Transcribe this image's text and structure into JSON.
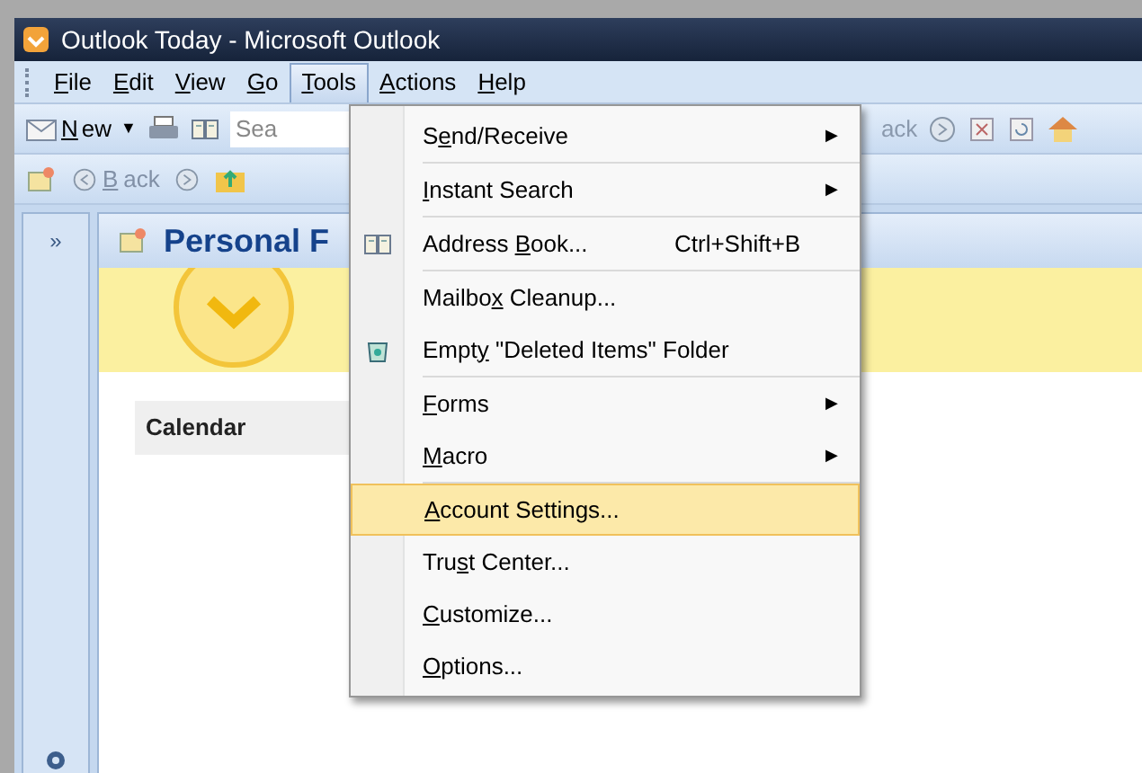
{
  "window": {
    "title": "Outlook Today - Microsoft Outlook"
  },
  "menu_bar": [
    {
      "key": "F",
      "after": "ile",
      "selected": false
    },
    {
      "key": "E",
      "after": "dit",
      "selected": false
    },
    {
      "key": "V",
      "after": "iew",
      "selected": false
    },
    {
      "key": "G",
      "after": "o",
      "selected": false
    },
    {
      "key": "T",
      "after": "ools",
      "selected": true
    },
    {
      "key": "A",
      "after": "ctions",
      "selected": false
    },
    {
      "key": "H",
      "after": "elp",
      "selected": false
    }
  ],
  "toolbar": {
    "new_button": {
      "key": "N",
      "after": "ew",
      "dropdown_glyph": "▼"
    },
    "search_text": "Sea",
    "back_text_cut": "ack"
  },
  "nav_toolbar": {
    "back_button": {
      "key": "B",
      "after": "ack"
    }
  },
  "nav_pane": {
    "expand_label": "»"
  },
  "content": {
    "header": "Personal F",
    "section": "Calendar"
  },
  "tools_menu": [
    {
      "kind": "plain",
      "before": "S",
      "key": "e",
      "after": "nd/Receive",
      "submenu_arrow": "▶",
      "selected": false,
      "separator_after": true
    },
    {
      "kind": "plain",
      "key": "I",
      "after": "nstant Search",
      "submenu_arrow": "▶",
      "selected": false,
      "separator_after": true
    },
    {
      "kind": "book",
      "before": "Address ",
      "key": "B",
      "after": "ook...",
      "shortcut": "Ctrl+Shift+B",
      "selected": false,
      "separator_after": true
    },
    {
      "kind": "plain",
      "before": "Mailbo",
      "key": "x",
      "after": " Cleanup...",
      "selected": false,
      "separator_after": false
    },
    {
      "kind": "bin",
      "before": "Empt",
      "key": "y",
      "after": " \"Deleted Items\" Folder",
      "selected": false,
      "separator_after": true
    },
    {
      "kind": "plain",
      "key": "F",
      "after": "orms",
      "submenu_arrow": "▶",
      "selected": false,
      "separator_after": false
    },
    {
      "kind": "plain",
      "key": "M",
      "after": "acro",
      "submenu_arrow": "▶",
      "selected": false,
      "separator_after": true
    },
    {
      "kind": "plain",
      "key": "A",
      "after": "ccount Settings...",
      "selected": true,
      "separator_after": false
    },
    {
      "kind": "plain",
      "before": "Tru",
      "key": "s",
      "after": "t Center...",
      "selected": false,
      "separator_after": false
    },
    {
      "kind": "plain",
      "key": "C",
      "after": "ustomize...",
      "selected": false,
      "separator_after": false
    },
    {
      "kind": "plain",
      "key": "O",
      "after": "ptions...",
      "selected": false,
      "separator_after": false
    }
  ]
}
